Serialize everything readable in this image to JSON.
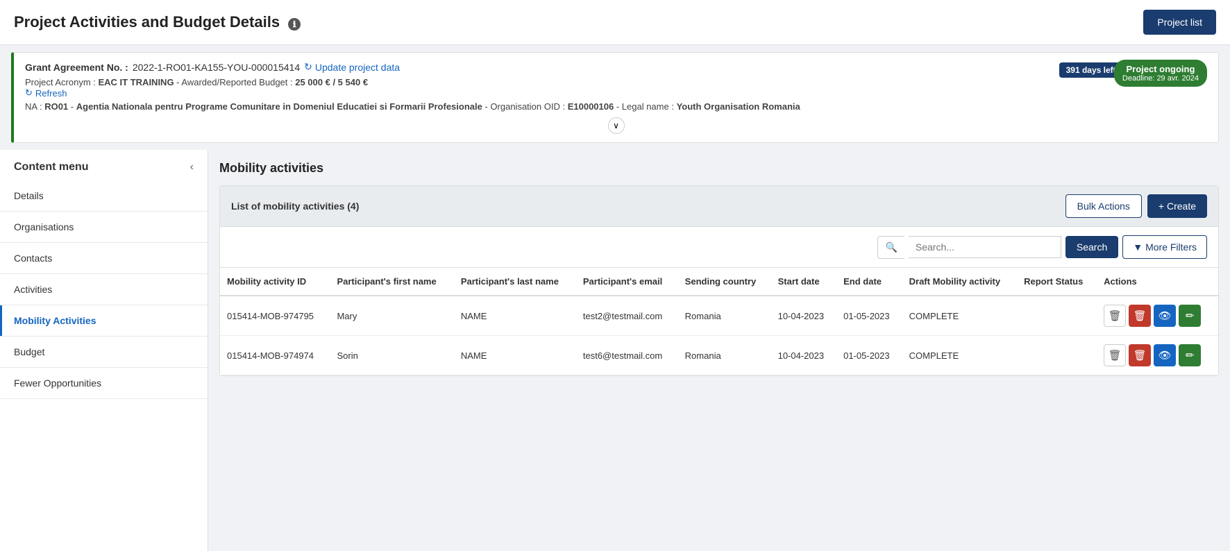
{
  "header": {
    "title": "Project Activities and Budget Details",
    "project_list_btn": "Project list"
  },
  "info_box": {
    "grant_label": "Grant Agreement No. :",
    "grant_number": "2022-1-RO01-KA155-YOU-000015414",
    "update_link": "Update project data",
    "project_acronym_label": "Project Acronym :",
    "project_acronym": "EAC IT TRAINING",
    "awarded_label": "Awarded/Reported Budget :",
    "awarded_budget": "25 000 € / 5 540 €",
    "refresh_link": "Refresh",
    "na_label": "NA :",
    "na_code": "RO01",
    "na_name": "Agentia Nationala pentru Programe Comunitare in Domeniul Educatiei si Formarii Profesionale",
    "org_oid_label": "Organisation OID :",
    "org_oid": "E10000106",
    "legal_name_label": "Legal name :",
    "legal_name": "Youth Organisation Romania",
    "days_left": "391 days left !",
    "project_status": "Project ongoing",
    "deadline_label": "Deadline: 29 avr. 2024"
  },
  "sidebar": {
    "title": "Content menu",
    "collapse_icon": "‹",
    "items": [
      {
        "id": "details",
        "label": "Details",
        "active": false
      },
      {
        "id": "organisations",
        "label": "Organisations",
        "active": false
      },
      {
        "id": "contacts",
        "label": "Contacts",
        "active": false
      },
      {
        "id": "activities",
        "label": "Activities",
        "active": false
      },
      {
        "id": "mobility-activities",
        "label": "Mobility Activities",
        "active": true
      },
      {
        "id": "budget",
        "label": "Budget",
        "active": false
      },
      {
        "id": "fewer-opportunities",
        "label": "Fewer Opportunities",
        "active": false
      }
    ]
  },
  "mobility_activities": {
    "section_title": "Mobility activities",
    "list_label": "List of mobility activities (4)",
    "bulk_actions_btn": "Bulk Actions",
    "create_btn": "+ Create",
    "search_placeholder": "Search...",
    "search_btn": "Search",
    "more_filters_btn": "More Filters",
    "table": {
      "columns": [
        "Mobility activity ID",
        "Participant's first name",
        "Participant's last name",
        "Participant's email",
        "Sending country",
        "Start date",
        "End date",
        "Draft Mobility activity",
        "Report Status",
        "Actions"
      ],
      "rows": [
        {
          "id": "015414-MOB-974795",
          "first_name": "Mary",
          "last_name": "NAME",
          "email": "test2@testmail.com",
          "sending_country": "Romania",
          "start_date": "10-04-2023",
          "end_date": "01-05-2023",
          "draft": "COMPLETE",
          "report_status": ""
        },
        {
          "id": "015414-MOB-974974",
          "first_name": "Sorin",
          "last_name": "NAME",
          "email": "test6@testmail.com",
          "sending_country": "Romania",
          "start_date": "10-04-2023",
          "end_date": "01-05-2023",
          "draft": "COMPLETE",
          "report_status": ""
        }
      ]
    }
  },
  "icons": {
    "info": "ℹ",
    "refresh": "↻",
    "collapse": "‹",
    "search": "🔍",
    "filter": "▼",
    "delete": "🗑",
    "trash": "🗑",
    "view": "👁",
    "edit": "✏",
    "chevron_down": "∨"
  }
}
